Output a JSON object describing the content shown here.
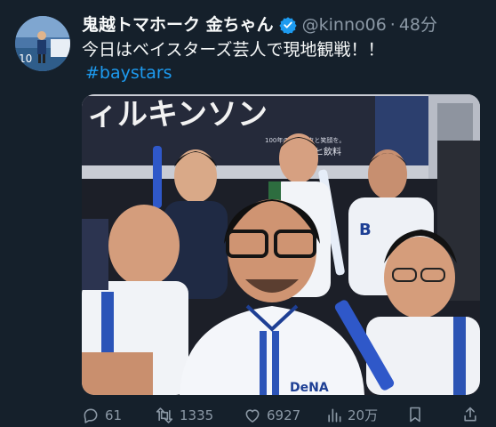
{
  "tweet": {
    "display_name": "鬼越トマホーク 金ちゃん",
    "handle": "@kinno06",
    "separator": "·",
    "time": "48分",
    "text": "今日はベイスターズ芸人で現地観戦！！",
    "hashtag": "#baystars",
    "verified_icon": "verified-badge-icon",
    "colors": {
      "background": "#15202b",
      "link": "#1d9bf0",
      "verified": "#1d9bf0",
      "muted": "#8b98a5"
    }
  },
  "media": {
    "banner_text": "ィルキンソン",
    "banner_subtext": "100年のワクワクと笑顔を。",
    "banner_brand": "アサヒ飲料",
    "jersey_text": "DeNA",
    "cap_text": "B"
  },
  "actions": {
    "replies": "61",
    "reposts": "1335",
    "likes": "6927",
    "views": "20万"
  }
}
